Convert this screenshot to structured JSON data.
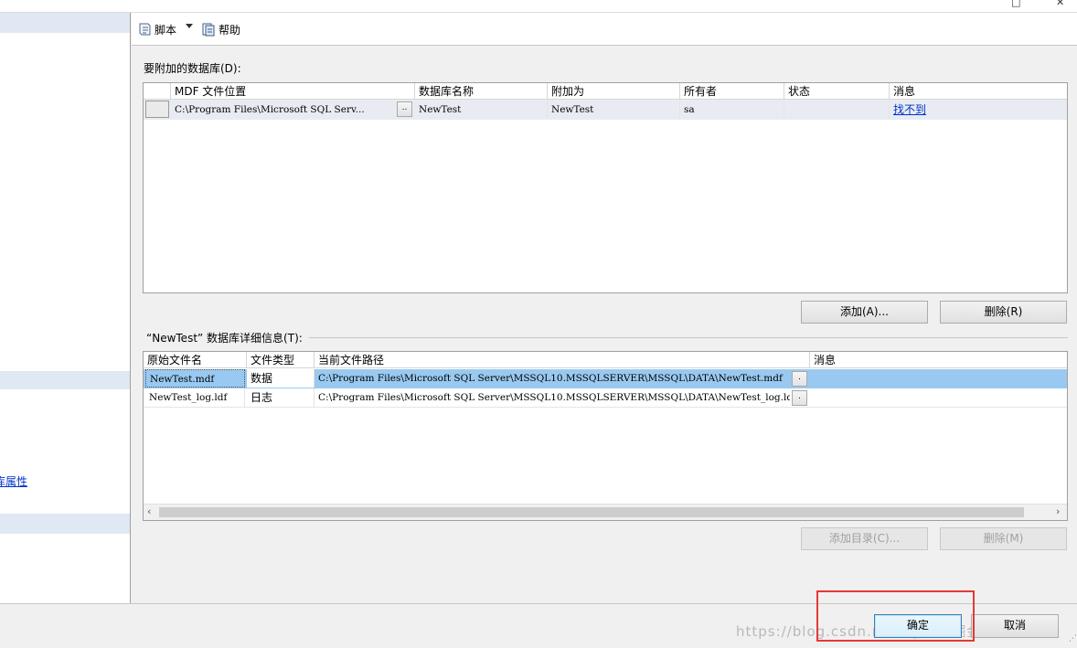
{
  "toolbar": {
    "script_label": "脚本",
    "help_label": "帮助"
  },
  "left_pane": {
    "link_text": "数据库属性"
  },
  "attach_section": {
    "title": "要附加的数据库(D):",
    "columns": [
      "MDF 文件位置",
      "数据库名称",
      "附加为",
      "所有者",
      "状态",
      "消息"
    ],
    "rows": [
      {
        "mdf": "C:\\Program Files\\Microsoft SQL Serv...",
        "ellipsis": "..",
        "db_name": "NewTest",
        "attach_as": "NewTest",
        "owner": "sa",
        "status": "",
        "message": "找不到"
      }
    ],
    "add_button": "添加(A)...",
    "remove_button": "删除(R)"
  },
  "details_section": {
    "title": "“NewTest” 数据库详细信息(T):",
    "columns": [
      "原始文件名",
      "文件类型",
      "当前文件路径",
      "消息"
    ],
    "rows": [
      {
        "file": "NewTest.mdf",
        "type": "数据",
        "path": "C:\\Program Files\\Microsoft SQL Server\\MSSQL10.MSSQLSERVER\\MSSQL\\DATA\\NewTest.mdf",
        "ellipsis": ".",
        "message": ""
      },
      {
        "file": "NewTest_log.ldf",
        "type": "日志",
        "path": "C:\\Program Files\\Microsoft SQL Server\\MSSQL10.MSSQLSERVER\\MSSQL\\DATA\\NewTest_log.ldf",
        "ellipsis": ".",
        "message": ""
      }
    ],
    "add_catalog_button": "添加目录(C)...",
    "remove_button": "删除(M)"
  },
  "dialog_buttons": {
    "ok": "确定",
    "cancel": "取消"
  },
  "watermark": "https://blog.csdn.net/ @稀土掘金技术社区",
  "colors": {
    "selection": "#99c9f0",
    "link": "#0033cc",
    "highlight_box": "#e53935"
  }
}
